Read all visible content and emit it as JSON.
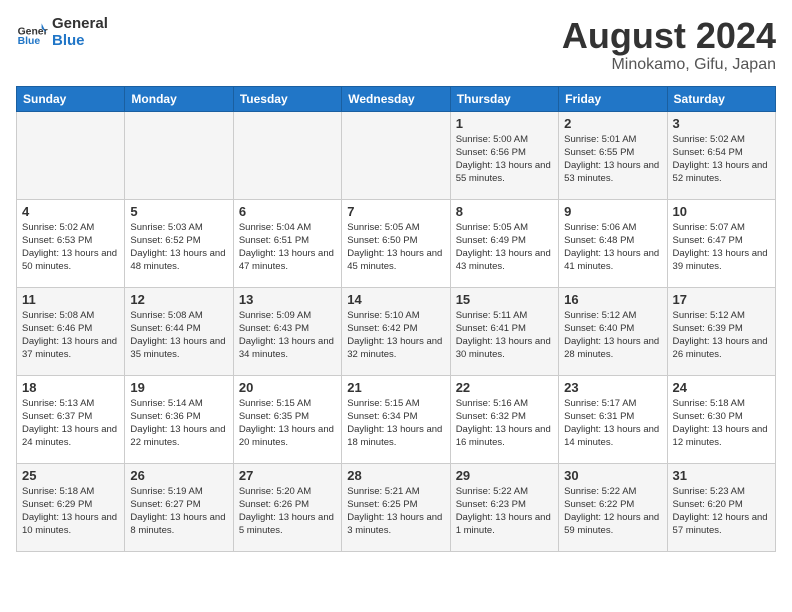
{
  "header": {
    "logo_general": "General",
    "logo_blue": "Blue",
    "title": "August 2024",
    "subtitle": "Minokamo, Gifu, Japan"
  },
  "weekdays": [
    "Sunday",
    "Monday",
    "Tuesday",
    "Wednesday",
    "Thursday",
    "Friday",
    "Saturday"
  ],
  "weeks": [
    [
      {
        "day": "",
        "content": ""
      },
      {
        "day": "",
        "content": ""
      },
      {
        "day": "",
        "content": ""
      },
      {
        "day": "",
        "content": ""
      },
      {
        "day": "1",
        "content": "Sunrise: 5:00 AM\nSunset: 6:56 PM\nDaylight: 13 hours\nand 55 minutes."
      },
      {
        "day": "2",
        "content": "Sunrise: 5:01 AM\nSunset: 6:55 PM\nDaylight: 13 hours\nand 53 minutes."
      },
      {
        "day": "3",
        "content": "Sunrise: 5:02 AM\nSunset: 6:54 PM\nDaylight: 13 hours\nand 52 minutes."
      }
    ],
    [
      {
        "day": "4",
        "content": "Sunrise: 5:02 AM\nSunset: 6:53 PM\nDaylight: 13 hours\nand 50 minutes."
      },
      {
        "day": "5",
        "content": "Sunrise: 5:03 AM\nSunset: 6:52 PM\nDaylight: 13 hours\nand 48 minutes."
      },
      {
        "day": "6",
        "content": "Sunrise: 5:04 AM\nSunset: 6:51 PM\nDaylight: 13 hours\nand 47 minutes."
      },
      {
        "day": "7",
        "content": "Sunrise: 5:05 AM\nSunset: 6:50 PM\nDaylight: 13 hours\nand 45 minutes."
      },
      {
        "day": "8",
        "content": "Sunrise: 5:05 AM\nSunset: 6:49 PM\nDaylight: 13 hours\nand 43 minutes."
      },
      {
        "day": "9",
        "content": "Sunrise: 5:06 AM\nSunset: 6:48 PM\nDaylight: 13 hours\nand 41 minutes."
      },
      {
        "day": "10",
        "content": "Sunrise: 5:07 AM\nSunset: 6:47 PM\nDaylight: 13 hours\nand 39 minutes."
      }
    ],
    [
      {
        "day": "11",
        "content": "Sunrise: 5:08 AM\nSunset: 6:46 PM\nDaylight: 13 hours\nand 37 minutes."
      },
      {
        "day": "12",
        "content": "Sunrise: 5:08 AM\nSunset: 6:44 PM\nDaylight: 13 hours\nand 35 minutes."
      },
      {
        "day": "13",
        "content": "Sunrise: 5:09 AM\nSunset: 6:43 PM\nDaylight: 13 hours\nand 34 minutes."
      },
      {
        "day": "14",
        "content": "Sunrise: 5:10 AM\nSunset: 6:42 PM\nDaylight: 13 hours\nand 32 minutes."
      },
      {
        "day": "15",
        "content": "Sunrise: 5:11 AM\nSunset: 6:41 PM\nDaylight: 13 hours\nand 30 minutes."
      },
      {
        "day": "16",
        "content": "Sunrise: 5:12 AM\nSunset: 6:40 PM\nDaylight: 13 hours\nand 28 minutes."
      },
      {
        "day": "17",
        "content": "Sunrise: 5:12 AM\nSunset: 6:39 PM\nDaylight: 13 hours\nand 26 minutes."
      }
    ],
    [
      {
        "day": "18",
        "content": "Sunrise: 5:13 AM\nSunset: 6:37 PM\nDaylight: 13 hours\nand 24 minutes."
      },
      {
        "day": "19",
        "content": "Sunrise: 5:14 AM\nSunset: 6:36 PM\nDaylight: 13 hours\nand 22 minutes."
      },
      {
        "day": "20",
        "content": "Sunrise: 5:15 AM\nSunset: 6:35 PM\nDaylight: 13 hours\nand 20 minutes."
      },
      {
        "day": "21",
        "content": "Sunrise: 5:15 AM\nSunset: 6:34 PM\nDaylight: 13 hours\nand 18 minutes."
      },
      {
        "day": "22",
        "content": "Sunrise: 5:16 AM\nSunset: 6:32 PM\nDaylight: 13 hours\nand 16 minutes."
      },
      {
        "day": "23",
        "content": "Sunrise: 5:17 AM\nSunset: 6:31 PM\nDaylight: 13 hours\nand 14 minutes."
      },
      {
        "day": "24",
        "content": "Sunrise: 5:18 AM\nSunset: 6:30 PM\nDaylight: 13 hours\nand 12 minutes."
      }
    ],
    [
      {
        "day": "25",
        "content": "Sunrise: 5:18 AM\nSunset: 6:29 PM\nDaylight: 13 hours\nand 10 minutes."
      },
      {
        "day": "26",
        "content": "Sunrise: 5:19 AM\nSunset: 6:27 PM\nDaylight: 13 hours\nand 8 minutes."
      },
      {
        "day": "27",
        "content": "Sunrise: 5:20 AM\nSunset: 6:26 PM\nDaylight: 13 hours\nand 5 minutes."
      },
      {
        "day": "28",
        "content": "Sunrise: 5:21 AM\nSunset: 6:25 PM\nDaylight: 13 hours\nand 3 minutes."
      },
      {
        "day": "29",
        "content": "Sunrise: 5:22 AM\nSunset: 6:23 PM\nDaylight: 13 hours\nand 1 minute."
      },
      {
        "day": "30",
        "content": "Sunrise: 5:22 AM\nSunset: 6:22 PM\nDaylight: 12 hours\nand 59 minutes."
      },
      {
        "day": "31",
        "content": "Sunrise: 5:23 AM\nSunset: 6:20 PM\nDaylight: 12 hours\nand 57 minutes."
      }
    ]
  ]
}
